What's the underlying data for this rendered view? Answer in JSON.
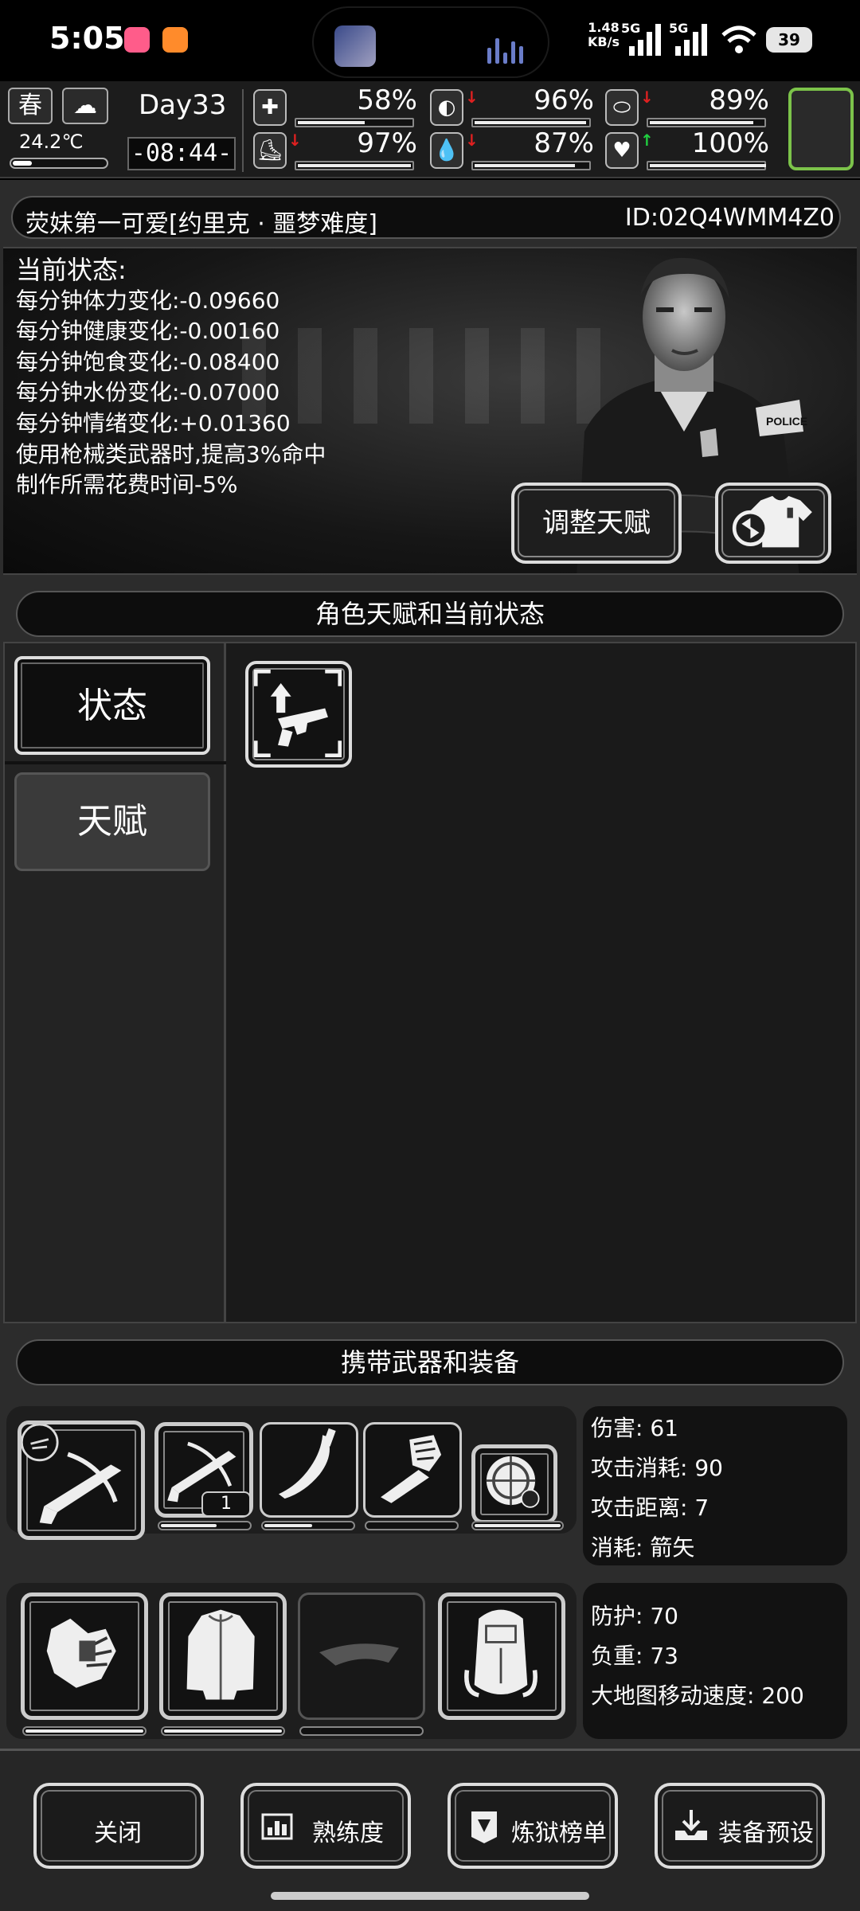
{
  "status_bar": {
    "time": "5:05",
    "speed_value": "1.48",
    "speed_unit": "KB/s",
    "network1": "5G",
    "network2": "5G",
    "battery": "39"
  },
  "hud": {
    "season": "春",
    "temperature": "24.2℃",
    "day": "Day33",
    "clock": "-08:44-",
    "stats": [
      {
        "name": "medical",
        "value": "58%",
        "arrow": "",
        "level": 0.58
      },
      {
        "name": "stomach",
        "value": "96%",
        "arrow": "down",
        "level": 0.96
      },
      {
        "name": "pill",
        "value": "89%",
        "arrow": "down",
        "level": 0.89
      },
      {
        "name": "stamina",
        "value": "97%",
        "arrow": "down",
        "level": 0.97
      },
      {
        "name": "water",
        "value": "87%",
        "arrow": "down",
        "level": 0.87
      },
      {
        "name": "mood",
        "value": "100%",
        "arrow": "up",
        "level": 1.0
      }
    ]
  },
  "character": {
    "name": "荧妹第一可爱[约里克 · 噩梦难度]",
    "id": "ID:02Q4WMM4Z0",
    "status_title": "当前状态:",
    "status_lines": [
      "每分钟体力变化:-0.09660",
      "每分钟健康变化:-0.00160",
      "每分钟饱食变化:-0.08400",
      "每分钟水份变化:-0.07000",
      "每分钟情绪变化:+0.01360",
      "使用枪械类武器时,提高3%命中",
      "制作所需花费时间-5%"
    ],
    "adjust_talent_label": "调整天赋"
  },
  "talent_section": {
    "title": "角色天赋和当前状态",
    "tabs": [
      "状态",
      "天赋"
    ]
  },
  "equipment_section": {
    "title": "携带武器和装备",
    "weapon_stats": [
      "伤害: 61",
      "攻击消耗: 90",
      "攻击距离: 7",
      "消耗: 箭矢"
    ],
    "gear_stats": [
      "防护: 70",
      "负重: 73",
      "大地图移动速度: 200"
    ],
    "ammo_count": "1",
    "durability": [
      0.6,
      0.55,
      0.0,
      1.0,
      1.0,
      1.0,
      0.0
    ]
  },
  "bottom_buttons": [
    "关闭",
    "熟练度",
    "炼狱榜单",
    "装备预设"
  ],
  "colors": {
    "accent_green": "#7cc34a",
    "arrow_down": "#e02020",
    "arrow_up": "#20d040"
  }
}
